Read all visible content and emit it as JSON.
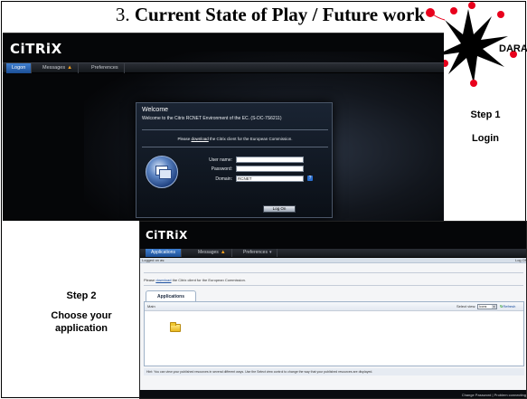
{
  "slide": {
    "title_number": "3.",
    "title_text": "Current State of Play / Future work"
  },
  "logo": {
    "text": "DARA",
    "colors": {
      "star": "#000000",
      "dots": "#e8001c"
    }
  },
  "screenshot1": {
    "brand": "CiTRiX",
    "tabs": [
      {
        "label": "Logon",
        "active": true
      },
      {
        "label": "Messages",
        "active": false,
        "icon": "warning-icon"
      },
      {
        "label": "Preferences",
        "active": false
      }
    ],
    "dialog": {
      "title": "Welcome",
      "subtitle": "Welcome to the Citrix RCNET Environment of the EC. (S-DC-7S6211)",
      "download_prefix": "Please ",
      "download_link": "download",
      "download_suffix": " the Citrix client for the European Commission.",
      "fields": {
        "username_label": "User name:",
        "username_value": "",
        "password_label": "Password:",
        "password_value": "",
        "domain_label": "Domain:",
        "domain_value": "RCNET"
      },
      "login_button": "Log On"
    }
  },
  "step1": {
    "line1": "Step 1",
    "line2": "Login"
  },
  "screenshot2": {
    "brand": "CiTRiX",
    "tabs": [
      {
        "label": "Applications",
        "active": true
      },
      {
        "label": "Messages",
        "active": false,
        "icon": "warning-icon"
      },
      {
        "label": "Preferences",
        "active": false
      }
    ],
    "logged_on_as": "Logged on as:",
    "log_off": "Log Of",
    "download_prefix": "Please ",
    "download_link": "download",
    "download_suffix": " the Citrix client for the European Commission.",
    "apps_tab": "Applications",
    "crumb": "Main",
    "select_view_label": "Select view:",
    "select_view_value": "Icons",
    "refresh_label": "Refresh",
    "hint": "Hint: You can view your published resources in several different ways. Use the Select view control to change the way that your published resources are displayed.",
    "footer_links": "Change Password | Problem connecting"
  },
  "step2": {
    "line1": "Step 2",
    "line2": "Choose your",
    "line3": "application"
  }
}
